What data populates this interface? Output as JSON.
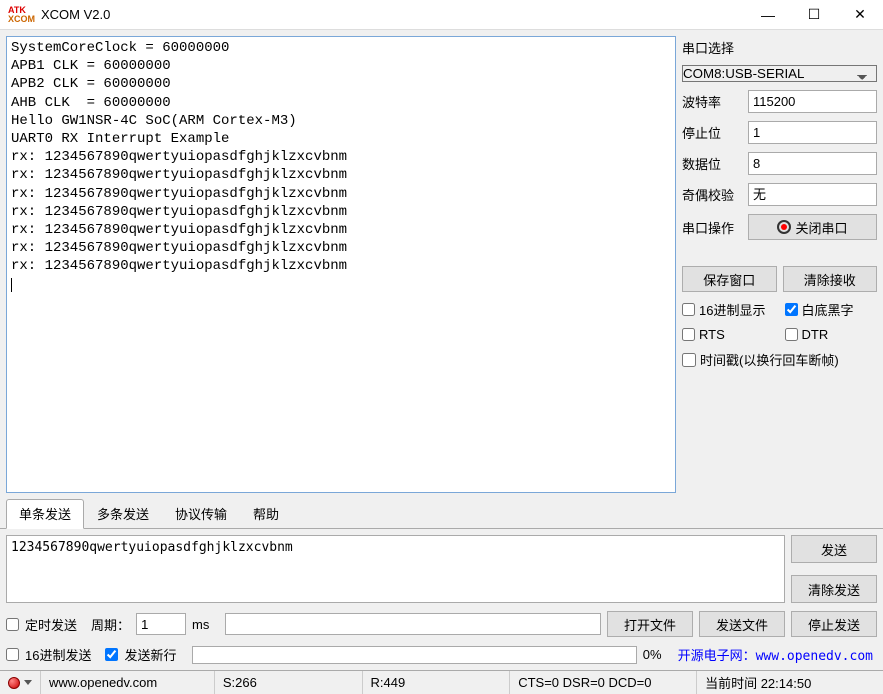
{
  "titlebar": {
    "logo1": "ATK",
    "logo2": "XCOM",
    "title": "XCOM V2.0"
  },
  "terminal": "SystemCoreClock = 60000000\nAPB1 CLK = 60000000\nAPB2 CLK = 60000000\nAHB CLK  = 60000000\nHello GW1NSR-4C SoC(ARM Cortex-M3)\nUART0 RX Interrupt Example\nrx: 1234567890qwertyuiopasdfghjklzxcvbnm\nrx: 1234567890qwertyuiopasdfghjklzxcvbnm\nrx: 1234567890qwertyuiopasdfghjklzxcvbnm\nrx: 1234567890qwertyuiopasdfghjklzxcvbnm\nrx: 1234567890qwertyuiopasdfghjklzxcvbnm\nrx: 1234567890qwertyuiopasdfghjklzxcvbnm\nrx: 1234567890qwertyuiopasdfghjklzxcvbnm",
  "sidebar": {
    "port_title": "串口选择",
    "port_value": "COM8:USB-SERIAL",
    "baud_label": "波特率",
    "baud_value": "115200",
    "stop_label": "停止位",
    "stop_value": "1",
    "data_label": "数据位",
    "data_value": "8",
    "parity_label": "奇偶校验",
    "parity_value": "无",
    "op_label": "串口操作",
    "op_btn": "关闭串口",
    "save_btn": "保存窗口",
    "clear_btn": "清除接收",
    "hex_disp": "16进制显示",
    "bw": "白底黑字",
    "rts": "RTS",
    "dtr": "DTR",
    "timestamp": "时间戳(以换行回车断帧)"
  },
  "tabs": {
    "t1": "单条发送",
    "t2": "多条发送",
    "t3": "协议传输",
    "t4": "帮助"
  },
  "send": {
    "text": "1234567890qwertyuiopasdfghjklzxcvbnm",
    "send_btn": "发送",
    "clear_btn": "清除发送"
  },
  "ctrl1": {
    "timed": "定时发送",
    "period_label": "周期：",
    "period_value": "1",
    "ms": "ms",
    "open_file": "打开文件",
    "send_file": "发送文件",
    "stop_send": "停止发送"
  },
  "ctrl2": {
    "hex_send": "16进制发送",
    "newline": "发送新行",
    "percent": "0%",
    "link": "开源电子网：www.openedv.com"
  },
  "status": {
    "url": "www.openedv.com",
    "s": "S:266",
    "r": "R:449",
    "sig": "CTS=0 DSR=0 DCD=0",
    "time": "当前时间 22:14:50"
  }
}
